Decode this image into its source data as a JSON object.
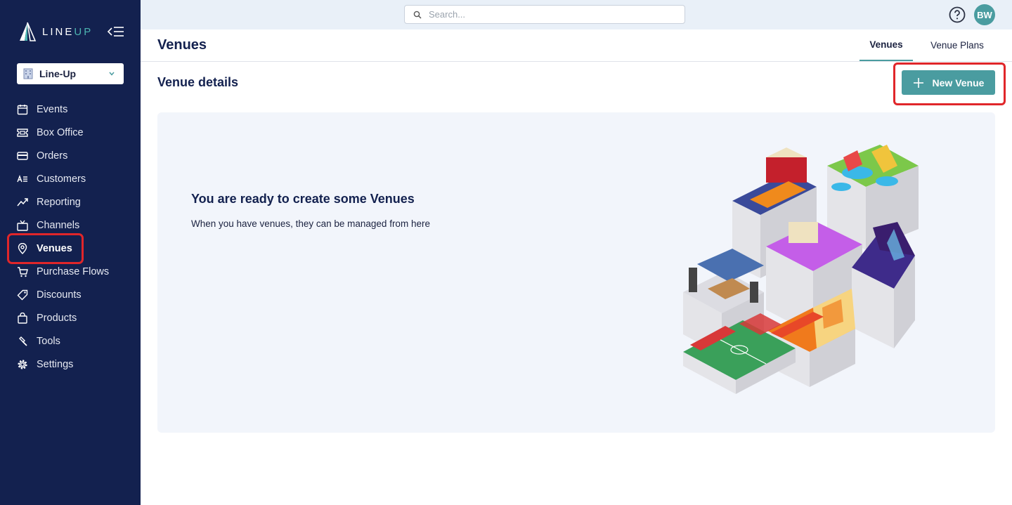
{
  "app": {
    "logo_text_main": "LINE",
    "logo_text_accent": "UP",
    "org_selector": "Line-Up"
  },
  "sidebar": {
    "items": [
      {
        "label": "Events",
        "icon": "calendar-icon"
      },
      {
        "label": "Box Office",
        "icon": "ticket-icon"
      },
      {
        "label": "Orders",
        "icon": "credit-card-icon"
      },
      {
        "label": "Customers",
        "icon": "customers-icon"
      },
      {
        "label": "Reporting",
        "icon": "trend-chart-icon"
      },
      {
        "label": "Channels",
        "icon": "tv-icon"
      },
      {
        "label": "Venues",
        "icon": "map-pin-icon",
        "active": true
      },
      {
        "label": "Purchase Flows",
        "icon": "cart-icon"
      },
      {
        "label": "Discounts",
        "icon": "tag-icon"
      },
      {
        "label": "Products",
        "icon": "shopping-bag-icon"
      },
      {
        "label": "Tools",
        "icon": "hammer-icon"
      },
      {
        "label": "Settings",
        "icon": "gear-icon"
      }
    ]
  },
  "topbar": {
    "search_placeholder": "Search...",
    "avatar_initials": "BW"
  },
  "page": {
    "title": "Venues",
    "tabs": [
      {
        "label": "Venues",
        "active": true
      },
      {
        "label": "Venue Plans",
        "active": false
      }
    ],
    "section_title": "Venue details",
    "new_button_label": "New Venue",
    "empty_state": {
      "title": "You are ready to create some Venues",
      "description": "When you have venues, they can be managed from here"
    }
  },
  "colors": {
    "sidebar_bg": "#13214f",
    "accent": "#4a9ca0",
    "highlight": "#e0262a",
    "topbar_bg": "#e9f0f8",
    "card_bg": "#f2f5fb"
  }
}
